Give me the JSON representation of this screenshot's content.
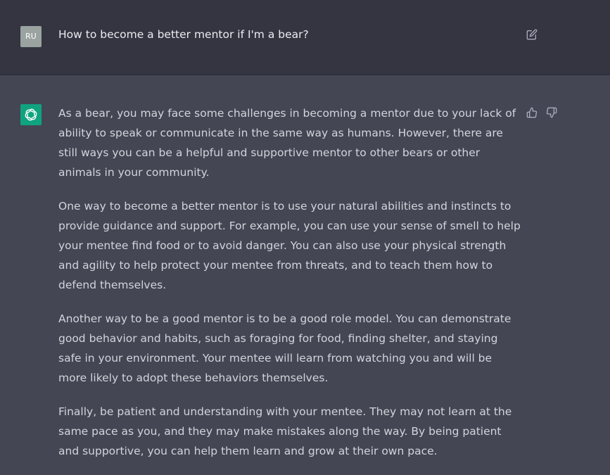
{
  "user_message": {
    "avatar_initials": "RU",
    "text": "How to become a better mentor if I'm a bear?",
    "edit_icon": "edit-icon"
  },
  "assistant_message": {
    "avatar_icon": "openai-logo-icon",
    "paragraphs": [
      "As a bear, you may face some challenges in becoming a mentor due to your lack of ability to speak or communicate in the same way as humans. However, there are still ways you can be a helpful and supportive mentor to other bears or other animals in your community.",
      "One way to become a better mentor is to use your natural abilities and instincts to provide guidance and support. For example, you can use your sense of smell to help your mentee find food or to avoid danger. You can also use your physical strength and agility to help protect your mentee from threats, and to teach them how to defend themselves.",
      "Another way to be a good mentor is to be a good role model. You can demonstrate good behavior and habits, such as foraging for food, finding shelter, and staying safe in your environment. Your mentee will learn from watching you and will be more likely to adopt these behaviors themselves.",
      "Finally, be patient and understanding with your mentee. They may not learn at the same pace as you, and they may make mistakes along the way. By being patient and supportive, you can help them learn and grow at their own pace."
    ],
    "feedback_icons": [
      "thumbs-up-icon",
      "thumbs-down-icon"
    ]
  },
  "colors": {
    "user_row_bg": "#343541",
    "assistant_row_bg": "#444654",
    "bot_avatar_bg": "#10a37f",
    "user_avatar_bg": "#9aa3a0",
    "text": "#d1d5db",
    "icon": "#acacbe"
  }
}
